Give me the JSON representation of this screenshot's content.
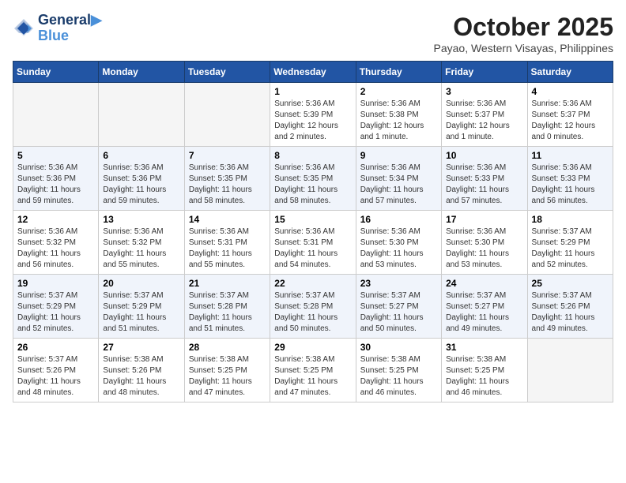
{
  "header": {
    "logo_line1": "General",
    "logo_line2": "Blue",
    "month": "October 2025",
    "location": "Payao, Western Visayas, Philippines"
  },
  "days_of_week": [
    "Sunday",
    "Monday",
    "Tuesday",
    "Wednesday",
    "Thursday",
    "Friday",
    "Saturday"
  ],
  "weeks": [
    [
      {
        "day": "",
        "info": ""
      },
      {
        "day": "",
        "info": ""
      },
      {
        "day": "",
        "info": ""
      },
      {
        "day": "1",
        "info": "Sunrise: 5:36 AM\nSunset: 5:39 PM\nDaylight: 12 hours\nand 2 minutes."
      },
      {
        "day": "2",
        "info": "Sunrise: 5:36 AM\nSunset: 5:38 PM\nDaylight: 12 hours\nand 1 minute."
      },
      {
        "day": "3",
        "info": "Sunrise: 5:36 AM\nSunset: 5:37 PM\nDaylight: 12 hours\nand 1 minute."
      },
      {
        "day": "4",
        "info": "Sunrise: 5:36 AM\nSunset: 5:37 PM\nDaylight: 12 hours\nand 0 minutes."
      }
    ],
    [
      {
        "day": "5",
        "info": "Sunrise: 5:36 AM\nSunset: 5:36 PM\nDaylight: 11 hours\nand 59 minutes."
      },
      {
        "day": "6",
        "info": "Sunrise: 5:36 AM\nSunset: 5:36 PM\nDaylight: 11 hours\nand 59 minutes."
      },
      {
        "day": "7",
        "info": "Sunrise: 5:36 AM\nSunset: 5:35 PM\nDaylight: 11 hours\nand 58 minutes."
      },
      {
        "day": "8",
        "info": "Sunrise: 5:36 AM\nSunset: 5:35 PM\nDaylight: 11 hours\nand 58 minutes."
      },
      {
        "day": "9",
        "info": "Sunrise: 5:36 AM\nSunset: 5:34 PM\nDaylight: 11 hours\nand 57 minutes."
      },
      {
        "day": "10",
        "info": "Sunrise: 5:36 AM\nSunset: 5:33 PM\nDaylight: 11 hours\nand 57 minutes."
      },
      {
        "day": "11",
        "info": "Sunrise: 5:36 AM\nSunset: 5:33 PM\nDaylight: 11 hours\nand 56 minutes."
      }
    ],
    [
      {
        "day": "12",
        "info": "Sunrise: 5:36 AM\nSunset: 5:32 PM\nDaylight: 11 hours\nand 56 minutes."
      },
      {
        "day": "13",
        "info": "Sunrise: 5:36 AM\nSunset: 5:32 PM\nDaylight: 11 hours\nand 55 minutes."
      },
      {
        "day": "14",
        "info": "Sunrise: 5:36 AM\nSunset: 5:31 PM\nDaylight: 11 hours\nand 55 minutes."
      },
      {
        "day": "15",
        "info": "Sunrise: 5:36 AM\nSunset: 5:31 PM\nDaylight: 11 hours\nand 54 minutes."
      },
      {
        "day": "16",
        "info": "Sunrise: 5:36 AM\nSunset: 5:30 PM\nDaylight: 11 hours\nand 53 minutes."
      },
      {
        "day": "17",
        "info": "Sunrise: 5:36 AM\nSunset: 5:30 PM\nDaylight: 11 hours\nand 53 minutes."
      },
      {
        "day": "18",
        "info": "Sunrise: 5:37 AM\nSunset: 5:29 PM\nDaylight: 11 hours\nand 52 minutes."
      }
    ],
    [
      {
        "day": "19",
        "info": "Sunrise: 5:37 AM\nSunset: 5:29 PM\nDaylight: 11 hours\nand 52 minutes."
      },
      {
        "day": "20",
        "info": "Sunrise: 5:37 AM\nSunset: 5:29 PM\nDaylight: 11 hours\nand 51 minutes."
      },
      {
        "day": "21",
        "info": "Sunrise: 5:37 AM\nSunset: 5:28 PM\nDaylight: 11 hours\nand 51 minutes."
      },
      {
        "day": "22",
        "info": "Sunrise: 5:37 AM\nSunset: 5:28 PM\nDaylight: 11 hours\nand 50 minutes."
      },
      {
        "day": "23",
        "info": "Sunrise: 5:37 AM\nSunset: 5:27 PM\nDaylight: 11 hours\nand 50 minutes."
      },
      {
        "day": "24",
        "info": "Sunrise: 5:37 AM\nSunset: 5:27 PM\nDaylight: 11 hours\nand 49 minutes."
      },
      {
        "day": "25",
        "info": "Sunrise: 5:37 AM\nSunset: 5:26 PM\nDaylight: 11 hours\nand 49 minutes."
      }
    ],
    [
      {
        "day": "26",
        "info": "Sunrise: 5:37 AM\nSunset: 5:26 PM\nDaylight: 11 hours\nand 48 minutes."
      },
      {
        "day": "27",
        "info": "Sunrise: 5:38 AM\nSunset: 5:26 PM\nDaylight: 11 hours\nand 48 minutes."
      },
      {
        "day": "28",
        "info": "Sunrise: 5:38 AM\nSunset: 5:25 PM\nDaylight: 11 hours\nand 47 minutes."
      },
      {
        "day": "29",
        "info": "Sunrise: 5:38 AM\nSunset: 5:25 PM\nDaylight: 11 hours\nand 47 minutes."
      },
      {
        "day": "30",
        "info": "Sunrise: 5:38 AM\nSunset: 5:25 PM\nDaylight: 11 hours\nand 46 minutes."
      },
      {
        "day": "31",
        "info": "Sunrise: 5:38 AM\nSunset: 5:25 PM\nDaylight: 11 hours\nand 46 minutes."
      },
      {
        "day": "",
        "info": ""
      }
    ]
  ]
}
